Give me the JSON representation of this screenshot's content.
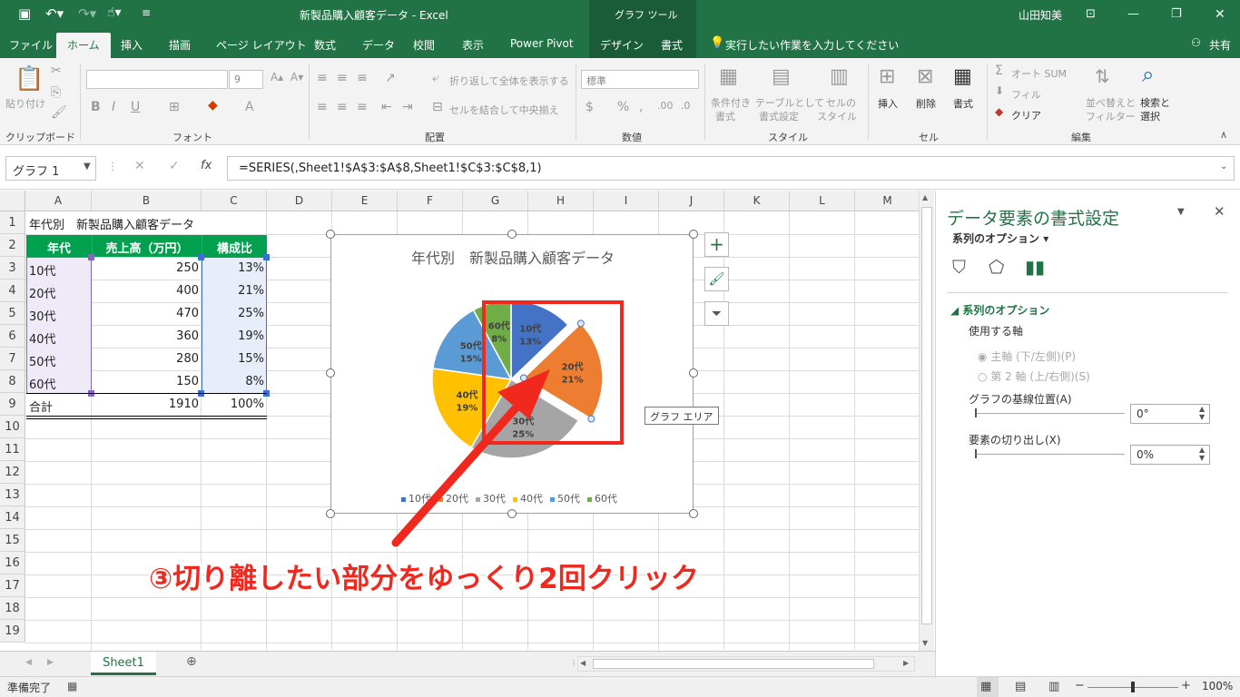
{
  "titlebar": {
    "file_title": "新製品購入顧客データ  -  Excel",
    "tool_title": "グラフ ツール",
    "user": "山田知美"
  },
  "tabs": [
    {
      "label": "ファイル"
    },
    {
      "label": "ホーム"
    },
    {
      "label": "挿入"
    },
    {
      "label": "描画"
    },
    {
      "label": "ページ レイアウト"
    },
    {
      "label": "数式"
    },
    {
      "label": "データ"
    },
    {
      "label": "校閲"
    },
    {
      "label": "表示"
    },
    {
      "label": "Power Pivot"
    },
    {
      "label": "デザイン"
    },
    {
      "label": "書式"
    }
  ],
  "tellme": "実行したい作業を入力してください",
  "share": "共有",
  "ribbon": {
    "clipboard": {
      "paste": "貼り付け",
      "group": "クリップボード"
    },
    "font": {
      "size": "9",
      "group": "フォント"
    },
    "alignment": {
      "wrap": "折り返して全体を表示する",
      "merge": "セルを結合して中央揃え",
      "group": "配置"
    },
    "number": {
      "format": "標準",
      "group": "数値"
    },
    "styles": {
      "conditional1": "条件付き",
      "conditional2": "書式",
      "table1": "テーブルとして",
      "table2": "書式設定",
      "cell1": "セルの",
      "cell2": "スタイル",
      "group": "スタイル"
    },
    "cells": {
      "insert": "挿入",
      "delete": "削除",
      "format": "書式",
      "group": "セル"
    },
    "editing": {
      "autosum": "オート SUM",
      "fill": "フィル",
      "clear": "クリア",
      "sort1": "並べ替えと",
      "sort2": "フィルター",
      "find1": "検索と",
      "find2": "選択",
      "group": "編集"
    }
  },
  "formula_bar": {
    "name_box": "グラフ 1",
    "formula": "=SERIES(,Sheet1!$A$3:$A$8,Sheet1!$C$3:$C$8,1)"
  },
  "columns": [
    "A",
    "B",
    "C",
    "D",
    "E",
    "F",
    "G",
    "H",
    "I",
    "J",
    "K",
    "L",
    "M"
  ],
  "rows": [
    "1",
    "2",
    "3",
    "4",
    "5",
    "6",
    "7",
    "8",
    "9",
    "10",
    "11",
    "12",
    "13",
    "14",
    "15",
    "16",
    "17",
    "18",
    "19"
  ],
  "sheet": {
    "title": "年代別　新製品購入顧客データ",
    "headers": [
      "年代",
      "売上高（万円）",
      "構成比"
    ],
    "data": [
      {
        "age": "10代",
        "sales": "250",
        "ratio": "13%"
      },
      {
        "age": "20代",
        "sales": "400",
        "ratio": "21%"
      },
      {
        "age": "30代",
        "sales": "470",
        "ratio": "25%"
      },
      {
        "age": "40代",
        "sales": "360",
        "ratio": "19%"
      },
      {
        "age": "50代",
        "sales": "280",
        "ratio": "15%"
      },
      {
        "age": "60代",
        "sales": "150",
        "ratio": "8%"
      }
    ],
    "total": {
      "label": "合計",
      "sales": "1910",
      "ratio": "100%"
    }
  },
  "chart_data": {
    "type": "pie",
    "title": "年代別　新製品購入顧客データ",
    "categories": [
      "10代",
      "20代",
      "30代",
      "40代",
      "50代",
      "60代"
    ],
    "values": [
      13,
      21,
      25,
      19,
      15,
      8
    ],
    "labels": [
      "13%",
      "21%",
      "25%",
      "19%",
      "15%",
      "8%"
    ],
    "colors": [
      "#4472c4",
      "#ed7d31",
      "#a5a5a5",
      "#ffc000",
      "#5b9bd5",
      "#70ad47"
    ],
    "exploded_index": 1,
    "legend_position": "bottom"
  },
  "chart_tooltip": "グラフ エリア",
  "annotation": "③切り離したい部分をゆっくり2回クリック",
  "pane": {
    "title": "データ要素の書式設定",
    "options_dropdown": "系列のオプション",
    "section": "系列のオプション",
    "axis_label": "使用する軸",
    "primary_axis": "主軸 (下/左側)(P)",
    "secondary_axis": "第 2 軸 (上/右側)(S)",
    "angle_label": "グラフの基線位置(A)",
    "angle_value": "0°",
    "explosion_label": "要素の切り出し(X)",
    "explosion_value": "0%"
  },
  "sheet_tab": "Sheet1",
  "status": {
    "ready": "準備完了",
    "zoom": "100%"
  }
}
